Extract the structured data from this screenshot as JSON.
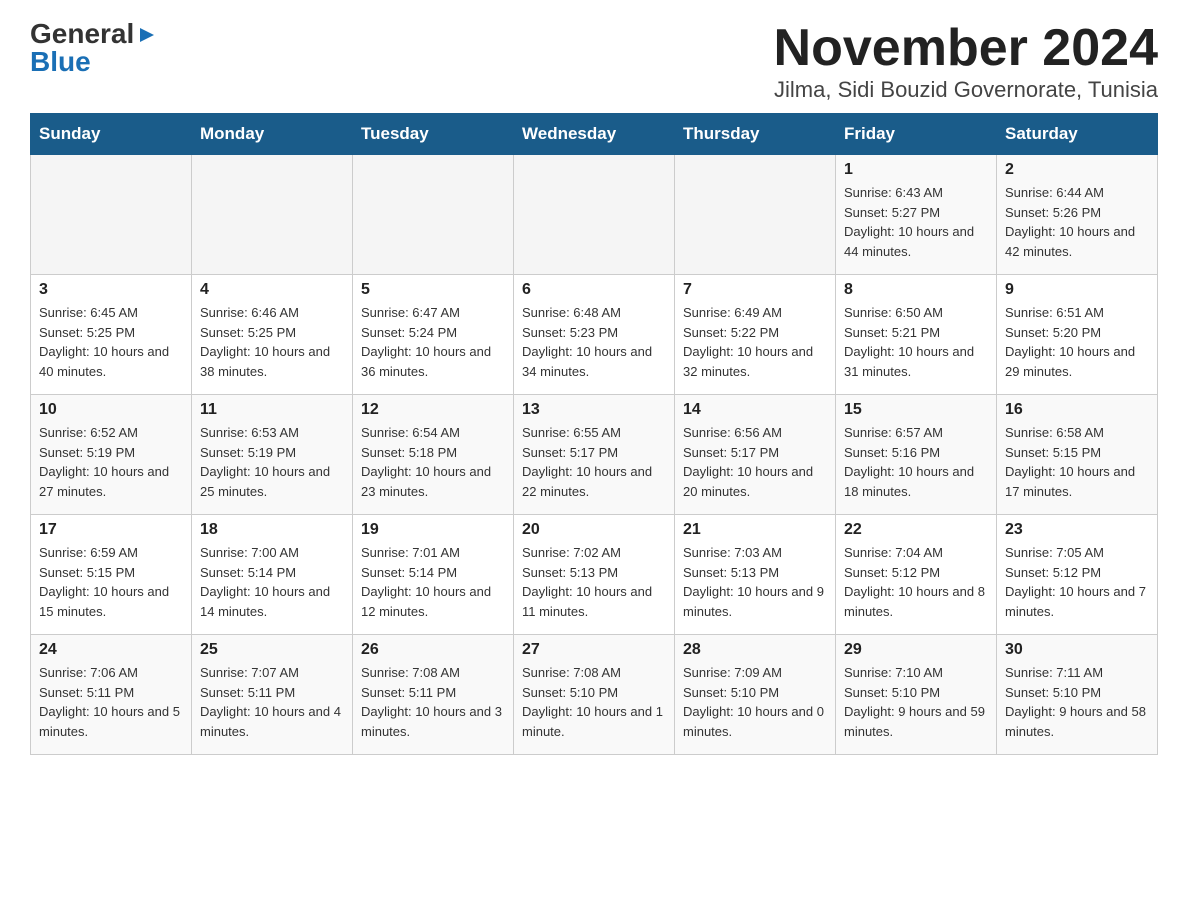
{
  "logo": {
    "line1": "General",
    "triangle": "▶",
    "line2": "Blue"
  },
  "title": "November 2024",
  "subtitle": "Jilma, Sidi Bouzid Governorate, Tunisia",
  "days_of_week": [
    "Sunday",
    "Monday",
    "Tuesday",
    "Wednesday",
    "Thursday",
    "Friday",
    "Saturday"
  ],
  "weeks": [
    [
      {
        "day": "",
        "info": ""
      },
      {
        "day": "",
        "info": ""
      },
      {
        "day": "",
        "info": ""
      },
      {
        "day": "",
        "info": ""
      },
      {
        "day": "",
        "info": ""
      },
      {
        "day": "1",
        "info": "Sunrise: 6:43 AM\nSunset: 5:27 PM\nDaylight: 10 hours and 44 minutes."
      },
      {
        "day": "2",
        "info": "Sunrise: 6:44 AM\nSunset: 5:26 PM\nDaylight: 10 hours and 42 minutes."
      }
    ],
    [
      {
        "day": "3",
        "info": "Sunrise: 6:45 AM\nSunset: 5:25 PM\nDaylight: 10 hours and 40 minutes."
      },
      {
        "day": "4",
        "info": "Sunrise: 6:46 AM\nSunset: 5:25 PM\nDaylight: 10 hours and 38 minutes."
      },
      {
        "day": "5",
        "info": "Sunrise: 6:47 AM\nSunset: 5:24 PM\nDaylight: 10 hours and 36 minutes."
      },
      {
        "day": "6",
        "info": "Sunrise: 6:48 AM\nSunset: 5:23 PM\nDaylight: 10 hours and 34 minutes."
      },
      {
        "day": "7",
        "info": "Sunrise: 6:49 AM\nSunset: 5:22 PM\nDaylight: 10 hours and 32 minutes."
      },
      {
        "day": "8",
        "info": "Sunrise: 6:50 AM\nSunset: 5:21 PM\nDaylight: 10 hours and 31 minutes."
      },
      {
        "day": "9",
        "info": "Sunrise: 6:51 AM\nSunset: 5:20 PM\nDaylight: 10 hours and 29 minutes."
      }
    ],
    [
      {
        "day": "10",
        "info": "Sunrise: 6:52 AM\nSunset: 5:19 PM\nDaylight: 10 hours and 27 minutes."
      },
      {
        "day": "11",
        "info": "Sunrise: 6:53 AM\nSunset: 5:19 PM\nDaylight: 10 hours and 25 minutes."
      },
      {
        "day": "12",
        "info": "Sunrise: 6:54 AM\nSunset: 5:18 PM\nDaylight: 10 hours and 23 minutes."
      },
      {
        "day": "13",
        "info": "Sunrise: 6:55 AM\nSunset: 5:17 PM\nDaylight: 10 hours and 22 minutes."
      },
      {
        "day": "14",
        "info": "Sunrise: 6:56 AM\nSunset: 5:17 PM\nDaylight: 10 hours and 20 minutes."
      },
      {
        "day": "15",
        "info": "Sunrise: 6:57 AM\nSunset: 5:16 PM\nDaylight: 10 hours and 18 minutes."
      },
      {
        "day": "16",
        "info": "Sunrise: 6:58 AM\nSunset: 5:15 PM\nDaylight: 10 hours and 17 minutes."
      }
    ],
    [
      {
        "day": "17",
        "info": "Sunrise: 6:59 AM\nSunset: 5:15 PM\nDaylight: 10 hours and 15 minutes."
      },
      {
        "day": "18",
        "info": "Sunrise: 7:00 AM\nSunset: 5:14 PM\nDaylight: 10 hours and 14 minutes."
      },
      {
        "day": "19",
        "info": "Sunrise: 7:01 AM\nSunset: 5:14 PM\nDaylight: 10 hours and 12 minutes."
      },
      {
        "day": "20",
        "info": "Sunrise: 7:02 AM\nSunset: 5:13 PM\nDaylight: 10 hours and 11 minutes."
      },
      {
        "day": "21",
        "info": "Sunrise: 7:03 AM\nSunset: 5:13 PM\nDaylight: 10 hours and 9 minutes."
      },
      {
        "day": "22",
        "info": "Sunrise: 7:04 AM\nSunset: 5:12 PM\nDaylight: 10 hours and 8 minutes."
      },
      {
        "day": "23",
        "info": "Sunrise: 7:05 AM\nSunset: 5:12 PM\nDaylight: 10 hours and 7 minutes."
      }
    ],
    [
      {
        "day": "24",
        "info": "Sunrise: 7:06 AM\nSunset: 5:11 PM\nDaylight: 10 hours and 5 minutes."
      },
      {
        "day": "25",
        "info": "Sunrise: 7:07 AM\nSunset: 5:11 PM\nDaylight: 10 hours and 4 minutes."
      },
      {
        "day": "26",
        "info": "Sunrise: 7:08 AM\nSunset: 5:11 PM\nDaylight: 10 hours and 3 minutes."
      },
      {
        "day": "27",
        "info": "Sunrise: 7:08 AM\nSunset: 5:10 PM\nDaylight: 10 hours and 1 minute."
      },
      {
        "day": "28",
        "info": "Sunrise: 7:09 AM\nSunset: 5:10 PM\nDaylight: 10 hours and 0 minutes."
      },
      {
        "day": "29",
        "info": "Sunrise: 7:10 AM\nSunset: 5:10 PM\nDaylight: 9 hours and 59 minutes."
      },
      {
        "day": "30",
        "info": "Sunrise: 7:11 AM\nSunset: 5:10 PM\nDaylight: 9 hours and 58 minutes."
      }
    ]
  ]
}
